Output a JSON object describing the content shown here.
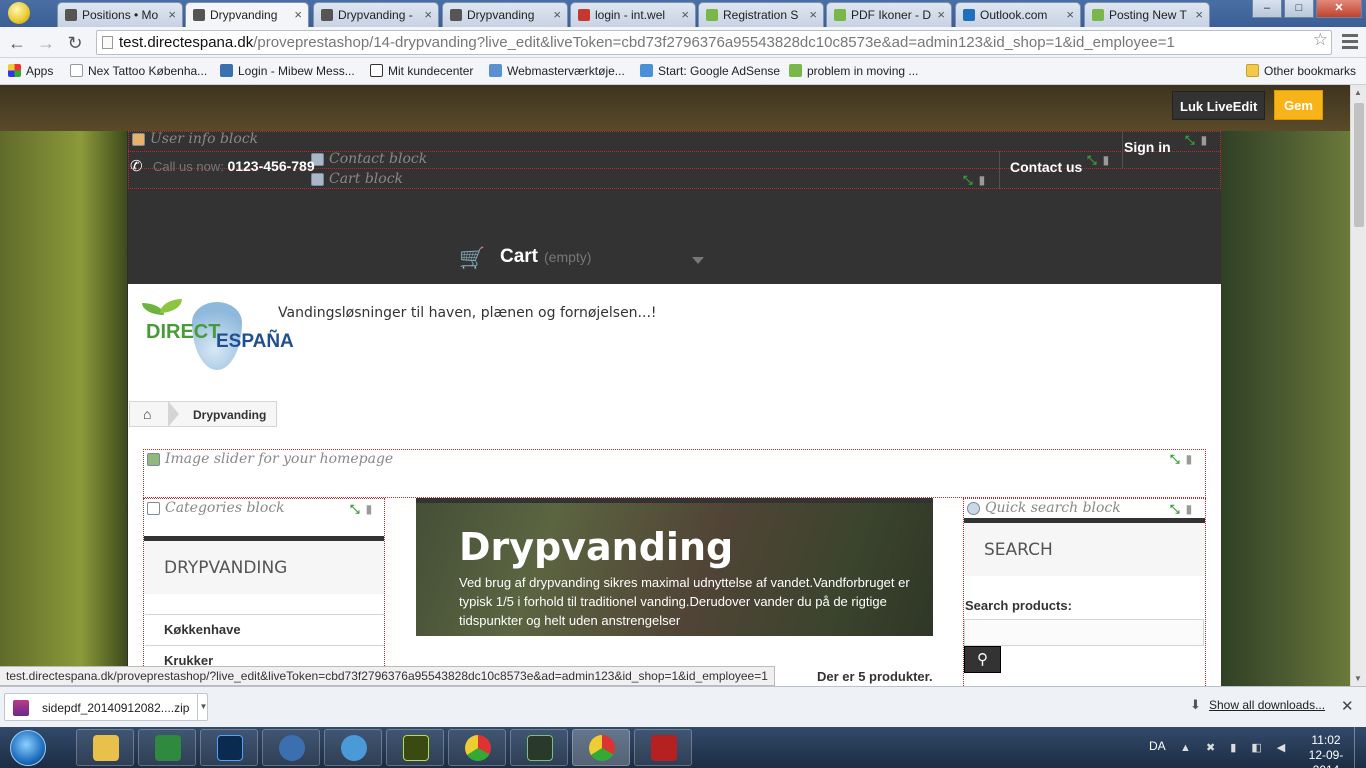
{
  "browser": {
    "tabs": [
      {
        "title": "Positions • Mo",
        "active": false
      },
      {
        "title": "Drypvanding",
        "active": true
      },
      {
        "title": "Drypvanding -",
        "active": false
      },
      {
        "title": "Drypvanding",
        "active": false
      },
      {
        "title": "login - int.wel",
        "active": false
      },
      {
        "title": "Registration S",
        "active": false
      },
      {
        "title": "PDF Ikoner - D",
        "active": false
      },
      {
        "title": "Outlook.com",
        "active": false
      },
      {
        "title": "Posting New T",
        "active": false
      }
    ],
    "url_host": "test.directespana.dk",
    "url_path": "/proveprestashop/14-drypvanding?live_edit&liveToken=cbd73f2796376a95543828dc10c8573e&ad=admin123&id_shop=1&id_employee=1",
    "bookmarks": [
      {
        "label": "Apps"
      },
      {
        "label": "Nex Tattoo Københa..."
      },
      {
        "label": "Login - Mibew Mess..."
      },
      {
        "label": "Mit kundecenter"
      },
      {
        "label": "Webmasterværktøje..."
      },
      {
        "label": "Start: Google AdSense"
      },
      {
        "label": "problem in moving ..."
      },
      {
        "label": "Other bookmarks"
      }
    ],
    "status_url": "test.directespana.dk/proveprestashop/?live_edit&liveToken=cbd73f2796376a95543828dc10c8573e&ad=admin123&id_shop=1&id_employee=1"
  },
  "liveedit": {
    "close_label": "Luk LiveEdit",
    "save_label": "Gem",
    "modules": {
      "user_info": "User info block",
      "contact": "Contact block",
      "cart": "Cart block",
      "slider": "Image slider for your homepage",
      "categories": "Categories block",
      "search": "Quick search block"
    }
  },
  "header": {
    "call_label": "Call us now:",
    "phone": "0123-456-789",
    "sign_in": "Sign in",
    "contact_us": "Contact us",
    "cart_label": "Cart",
    "cart_status": "(empty)"
  },
  "shop": {
    "logo_word1": "DIRECT",
    "logo_word2": "ESPAÑA",
    "tagline": "Vandingsløsninger til haven, plænen og fornøjelsen...!",
    "breadcrumb": "Drypvanding"
  },
  "categories": {
    "heading": "DRYPVANDING",
    "items": [
      "Køkkenhave",
      "Krukker"
    ]
  },
  "category_banner": {
    "title": "Drypvanding",
    "description": "Ved brug af drypvanding sikres maximal udnyttelse af vandet.Vandforbruget er typisk 1/5 i forhold til traditionel vanding.Derudover vander du på de rigtige tidspunkter og helt uden anstrengelser"
  },
  "product_count": "Der er 5 produkter.",
  "search": {
    "heading": "SEARCH",
    "label": "Search products:"
  },
  "downloads": {
    "file": "sidepdf_20140912082....zip",
    "show_all": "Show all downloads..."
  },
  "taskbar": {
    "language": "DA",
    "time": "11:02",
    "date": "12-09-2014"
  }
}
